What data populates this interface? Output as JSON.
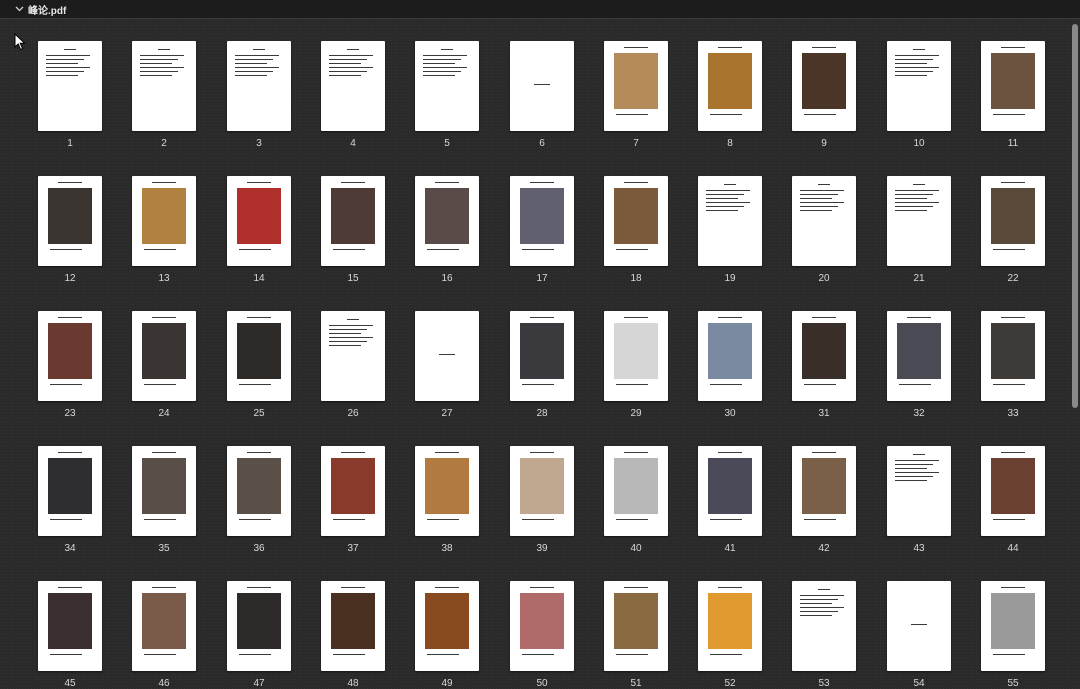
{
  "document": {
    "title": "峰论.pdf",
    "collapse_icon": "chevron-down-icon"
  },
  "pages": [
    {
      "label": "1",
      "kind": "text",
      "photo_color": ""
    },
    {
      "label": "2",
      "kind": "text",
      "photo_color": ""
    },
    {
      "label": "3",
      "kind": "text",
      "photo_color": ""
    },
    {
      "label": "4",
      "kind": "text",
      "photo_color": ""
    },
    {
      "label": "5",
      "kind": "text",
      "photo_color": ""
    },
    {
      "label": "6",
      "kind": "blank",
      "photo_color": ""
    },
    {
      "label": "7",
      "kind": "photo",
      "photo_color": "#b48a5a"
    },
    {
      "label": "8",
      "kind": "photo",
      "photo_color": "#a8742e"
    },
    {
      "label": "9",
      "kind": "photo",
      "photo_color": "#4a3526"
    },
    {
      "label": "10",
      "kind": "text",
      "photo_color": ""
    },
    {
      "label": "11",
      "kind": "photo",
      "photo_color": "#6b5340"
    },
    {
      "label": "12",
      "kind": "photo",
      "photo_color": "#3b3531"
    },
    {
      "label": "13",
      "kind": "photo",
      "photo_color": "#b08040"
    },
    {
      "label": "14",
      "kind": "photo",
      "photo_color": "#b0302c"
    },
    {
      "label": "15",
      "kind": "photo",
      "photo_color": "#4e3b36"
    },
    {
      "label": "16",
      "kind": "photo",
      "photo_color": "#5a4a48"
    },
    {
      "label": "17",
      "kind": "photo",
      "photo_color": "#606070"
    },
    {
      "label": "18",
      "kind": "photo",
      "photo_color": "#7a5a3a"
    },
    {
      "label": "19",
      "kind": "text",
      "photo_color": ""
    },
    {
      "label": "20",
      "kind": "text",
      "photo_color": ""
    },
    {
      "label": "21",
      "kind": "text",
      "photo_color": ""
    },
    {
      "label": "22",
      "kind": "photo",
      "photo_color": "#5a4a3a"
    },
    {
      "label": "23",
      "kind": "photo",
      "photo_color": "#6a3a30"
    },
    {
      "label": "24",
      "kind": "photo",
      "photo_color": "#3a3532"
    },
    {
      "label": "25",
      "kind": "photo",
      "photo_color": "#2e2a28"
    },
    {
      "label": "26",
      "kind": "text",
      "photo_color": ""
    },
    {
      "label": "27",
      "kind": "blank",
      "photo_color": ""
    },
    {
      "label": "28",
      "kind": "photo",
      "photo_color": "#3a3a3e"
    },
    {
      "label": "29",
      "kind": "photo",
      "photo_color": "#d6d6d6"
    },
    {
      "label": "30",
      "kind": "photo",
      "photo_color": "#7a8aa0"
    },
    {
      "label": "31",
      "kind": "photo",
      "photo_color": "#3a2e28"
    },
    {
      "label": "32",
      "kind": "photo",
      "photo_color": "#4a4a55"
    },
    {
      "label": "33",
      "kind": "photo",
      "photo_color": "#3e3a38"
    },
    {
      "label": "34",
      "kind": "photo",
      "photo_color": "#2e2e30"
    },
    {
      "label": "35",
      "kind": "photo",
      "photo_color": "#5a4e48"
    },
    {
      "label": "36",
      "kind": "photo",
      "photo_color": "#5a5048"
    },
    {
      "label": "37",
      "kind": "photo",
      "photo_color": "#8a3a2a"
    },
    {
      "label": "38",
      "kind": "photo",
      "photo_color": "#b07a40"
    },
    {
      "label": "39",
      "kind": "photo",
      "photo_color": "#c0a890"
    },
    {
      "label": "40",
      "kind": "photo",
      "photo_color": "#b8b8b8"
    },
    {
      "label": "41",
      "kind": "photo",
      "photo_color": "#4a4a58"
    },
    {
      "label": "42",
      "kind": "photo",
      "photo_color": "#7a6048"
    },
    {
      "label": "43",
      "kind": "text",
      "photo_color": ""
    },
    {
      "label": "44",
      "kind": "photo",
      "photo_color": "#6a4030"
    },
    {
      "label": "45",
      "kind": "photo",
      "photo_color": "#3a2e2e"
    },
    {
      "label": "46",
      "kind": "photo",
      "photo_color": "#7a5a48"
    },
    {
      "label": "47",
      "kind": "photo",
      "photo_color": "#2e2a2a"
    },
    {
      "label": "48",
      "kind": "photo",
      "photo_color": "#4a3020"
    },
    {
      "label": "49",
      "kind": "photo",
      "photo_color": "#8a4a20"
    },
    {
      "label": "50",
      "kind": "photo",
      "photo_color": "#b06a6a"
    },
    {
      "label": "51",
      "kind": "photo",
      "photo_color": "#8a6a40"
    },
    {
      "label": "52",
      "kind": "photo",
      "photo_color": "#e09a30"
    },
    {
      "label": "53",
      "kind": "text",
      "photo_color": ""
    },
    {
      "label": "54",
      "kind": "blank",
      "photo_color": ""
    },
    {
      "label": "55",
      "kind": "photo",
      "photo_color": "#9a9a9a"
    }
  ],
  "scrollbar": {
    "position_fraction": 0
  }
}
